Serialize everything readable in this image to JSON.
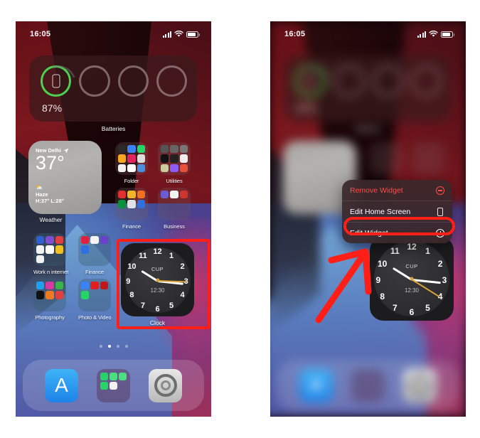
{
  "panels": [
    {
      "id": "home-screen-normal",
      "status_bar": {
        "time": "16:05",
        "signal_icon": "cellular-bars-icon",
        "wifi_icon": "wifi-icon",
        "battery_icon": "battery-icon"
      },
      "widgets": {
        "batteries": {
          "label": "Batteries",
          "percent": "87%",
          "rings": 4,
          "active_ring_index": 0,
          "active_color": "#4ad14f",
          "device_icon": "iphone-icon"
        },
        "weather": {
          "label": "Weather",
          "city": "New Delhi",
          "location_icon": "location-arrow-icon",
          "temperature": "37°",
          "condition_icon": "haze-icon",
          "condition": "Haze",
          "high_low": "H:37° L:28°"
        },
        "clock": {
          "label": "Clock",
          "city": "CUP",
          "digital_time": "12:30",
          "numerals": [
            "12",
            "1",
            "2",
            "3",
            "4",
            "5",
            "6",
            "7",
            "8",
            "9",
            "10",
            "11"
          ],
          "highlighted": true,
          "highlight_color": "#ff1f17"
        }
      },
      "apps": [
        {
          "name": "Folder",
          "row": 0,
          "col": 0
        },
        {
          "name": "Utilities",
          "row": 0,
          "col": 1
        },
        {
          "name": "Finance",
          "row": 1,
          "col": 0
        },
        {
          "name": "Business",
          "row": 1,
          "col": 1
        },
        {
          "name": "Work n internet",
          "row": 2,
          "col": 0
        },
        {
          "name": "Finance",
          "row": 2,
          "col": 1
        },
        {
          "name": "Photography",
          "row": 3,
          "col": 0
        },
        {
          "name": "Photo & Video",
          "row": 3,
          "col": 1
        }
      ],
      "page_dots": {
        "count": 4,
        "active_index": 1
      },
      "dock": [
        {
          "name": "App Store",
          "icon": "app-store-icon"
        },
        {
          "name": "Folder",
          "icon": "folder-icon"
        },
        {
          "name": "Settings",
          "icon": "settings-gear-icon"
        }
      ]
    },
    {
      "id": "home-screen-context-menu",
      "blurred": true,
      "status_bar": {
        "time": "16:05",
        "signal_icon": "cellular-bars-icon",
        "wifi_icon": "wifi-icon",
        "battery_icon": "battery-icon"
      },
      "context_menu": {
        "items": [
          {
            "label": "Remove Widget",
            "icon": "minus-circle-icon",
            "destructive": true,
            "highlighted": false
          },
          {
            "label": "Edit Home Screen",
            "icon": "iphone-icon",
            "destructive": false,
            "highlighted": false
          },
          {
            "label": "Edit Widget",
            "icon": "clock-circle-icon",
            "destructive": false,
            "highlighted": true
          }
        ],
        "highlight_color": "#ff1f17"
      },
      "widgets": {
        "clock": {
          "city": "CUP",
          "digital_time": "12:30",
          "numerals": [
            "12",
            "1",
            "2",
            "3",
            "4",
            "5",
            "6",
            "7",
            "8",
            "9",
            "10",
            "11"
          ]
        }
      },
      "annotation": {
        "arrow_icon": "red-arrow-up-right",
        "arrow_color": "#ff1f17",
        "points_to": "Edit Widget"
      }
    }
  ]
}
